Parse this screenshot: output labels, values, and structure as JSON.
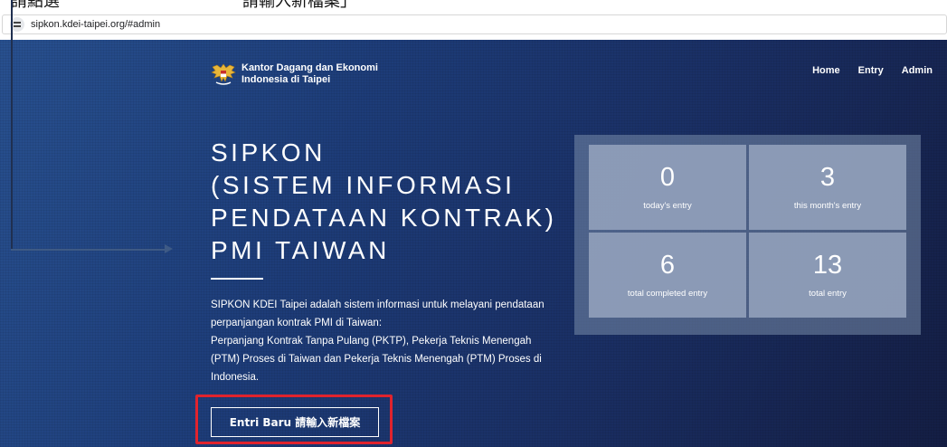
{
  "annotation": {
    "top_text_left": "請點選",
    "top_text_right": "請輸入新檔案」"
  },
  "browser": {
    "url": "sipkon.kdei-taipei.org/#admin",
    "site_info_icon": "tune-icon"
  },
  "brand": {
    "line1": "Kantor Dagang dan Ekonomi",
    "line2": "Indonesia di Taipei",
    "logo_icon": "garuda-logo"
  },
  "nav": {
    "items": [
      "Home",
      "Entry",
      "Admin"
    ]
  },
  "hero": {
    "title_lines": [
      "SIPKON",
      "(SISTEM INFORMASI",
      "PENDATAAN KONTRAK)",
      "PMI TAIWAN"
    ],
    "description_lines": [
      "SIPKON KDEI Taipei adalah sistem informasi untuk melayani pendataan",
      "perpanjangan kontrak PMI di Taiwan:",
      "Perpanjang Kontrak Tanpa Pulang (PKTP), Pekerja Teknis Menengah",
      "(PTM) Proses di Taiwan dan Pekerja Teknis Menengah (PTM) Proses di",
      "Indonesia."
    ],
    "cta_label": "Entri Baru 請輸入新檔案"
  },
  "stats": [
    {
      "value": "0",
      "label": "today's entry"
    },
    {
      "value": "3",
      "label": "this month's entry"
    },
    {
      "value": "6",
      "label": "total completed entry"
    },
    {
      "value": "13",
      "label": "total entry"
    }
  ],
  "colors": {
    "highlight": "#e0232d",
    "hero_dark": "#141e44",
    "hero_light": "#28508f"
  }
}
